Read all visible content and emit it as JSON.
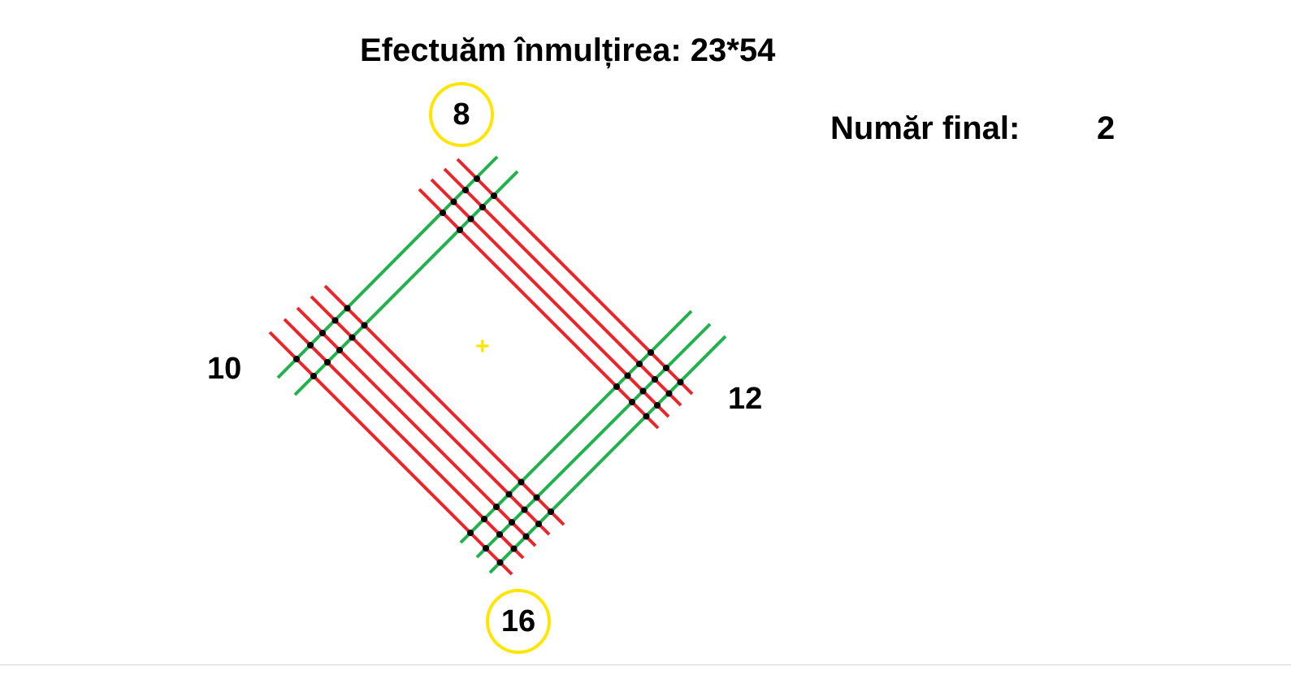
{
  "title": "Efectuăm înmulțirea: 23*54",
  "final": {
    "label": "Număr final:",
    "value": "2"
  },
  "counts": {
    "top": "8",
    "left": "10",
    "right": "12",
    "bottom": "16"
  },
  "colors": {
    "red_lines": "#E8262B",
    "green_lines": "#22B14C",
    "dots": "#000000",
    "circles": "#FFE600",
    "plus": "#FFE600"
  },
  "center_mark": "+"
}
